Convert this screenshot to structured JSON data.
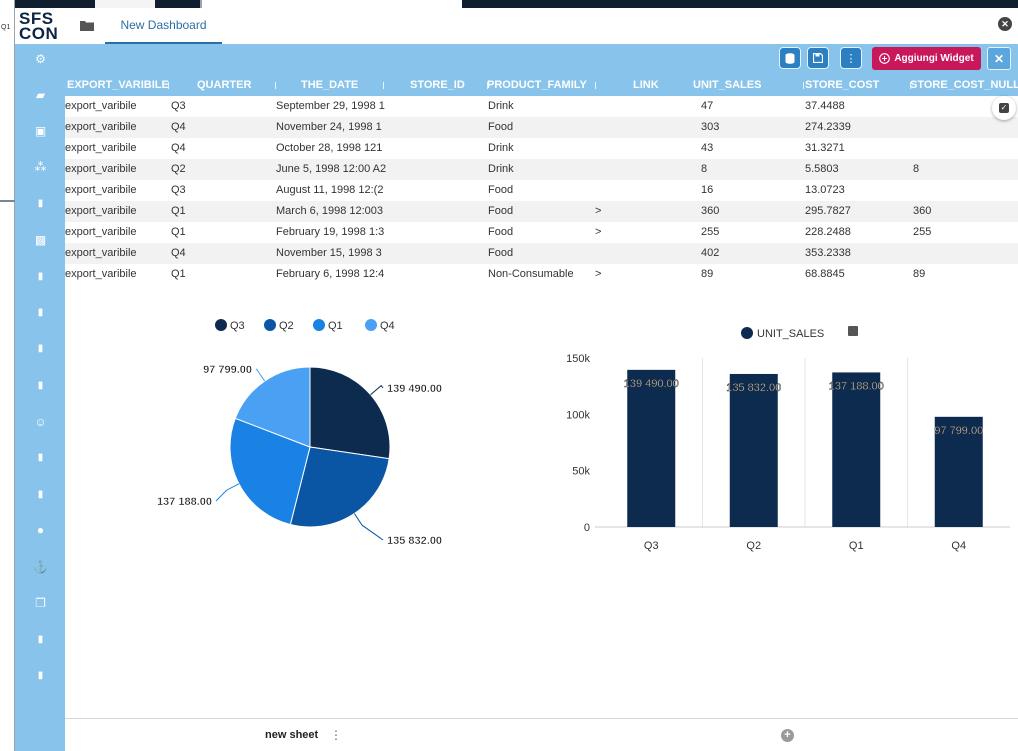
{
  "background": {
    "bg_label": "Q1"
  },
  "logo": {
    "line1": "SFS",
    "line2": "CON"
  },
  "tabs": {
    "dashboard_label": "New Dashboard"
  },
  "toolbar": {
    "add_widget_label": "Aggiungi Widget",
    "close_label": "✕",
    "more_label": "⋮"
  },
  "sidebar_icons": [
    "gear-icon",
    "folder-open-icon",
    "briefcase-icon",
    "network-icon",
    "document-icon",
    "image-icon",
    "document-icon",
    "document-icon",
    "document-icon",
    "document-icon",
    "smiley-icon",
    "document-icon",
    "document-icon",
    "apple-icon",
    "anchor-icon",
    "layers-icon",
    "document-icon",
    "document-icon"
  ],
  "table": {
    "headers": [
      "EXPORT_VARIBILE",
      "QUARTER",
      "THE_DATE",
      "STORE_ID",
      "PRODUCT_FAMILY",
      "LINK",
      "UNIT_SALES",
      "STORE_COST",
      "STORE_COST_NULL"
    ],
    "rows": [
      [
        "export_varibile",
        "Q3",
        "September 29, 1998 1",
        "",
        "Drink",
        "",
        "47",
        "37.4488",
        ""
      ],
      [
        "export_varibile",
        "Q4",
        "November 24, 1998 1",
        "",
        "Food",
        "",
        "303",
        "274.2339",
        ""
      ],
      [
        "export_varibile",
        "Q4",
        "October 28, 1998 121",
        "",
        "Drink",
        "",
        "43",
        "31.3271",
        ""
      ],
      [
        "export_varibile",
        "Q2",
        "June 5, 1998 12:00 A2",
        "",
        "Drink",
        "",
        "8",
        "5.5803",
        "8"
      ],
      [
        "export_varibile",
        "Q3",
        "August 11, 1998 12:(2",
        "",
        "Food",
        "",
        "16",
        "13.0723",
        ""
      ],
      [
        "export_varibile",
        "Q1",
        "March 6, 1998 12:003",
        "",
        "Food",
        ">",
        "360",
        "295.7827",
        "360"
      ],
      [
        "export_varibile",
        "Q1",
        "February 19, 1998 1:3",
        "",
        "Food",
        ">",
        "255",
        "228.2488",
        "255"
      ],
      [
        "export_varibile",
        "Q4",
        "November 15, 1998 3",
        "",
        "Food",
        "",
        "402",
        "353.2338",
        ""
      ],
      [
        "export_varibile",
        "Q1",
        "February 6, 1998 12:4",
        "",
        "Non-Consumable",
        ">",
        "89",
        "68.8845",
        "89"
      ]
    ]
  },
  "chart_data": [
    {
      "type": "pie",
      "categories": [
        "Q3",
        "Q2",
        "Q1",
        "Q4"
      ],
      "values": [
        139490,
        135832,
        137188,
        97799
      ],
      "labels": [
        "139 490.00",
        "135 832.00",
        "137 188.00",
        "97 799.00"
      ],
      "colors": [
        "#0d2b4e",
        "#0b56a4",
        "#1a82e5",
        "#4aa0f2"
      ],
      "legend_position": "top"
    },
    {
      "type": "bar",
      "categories": [
        "Q3",
        "Q2",
        "Q1",
        "Q4"
      ],
      "series": [
        {
          "name": "UNIT_SALES",
          "values": [
            139490,
            135832,
            137188,
            97799
          ]
        }
      ],
      "labels": [
        "139 490.00",
        "135 832.00",
        "137 188.00",
        "97 799.00"
      ],
      "y_ticks": [
        "0",
        "50k",
        "100k",
        "150k"
      ],
      "ylim": [
        0,
        150000
      ],
      "color": "#0d2b4e",
      "grid": "vertical",
      "legend_position": "top"
    }
  ],
  "footer": {
    "sheet_label": "new sheet",
    "menu_label": "⋮",
    "add_label": "+"
  }
}
